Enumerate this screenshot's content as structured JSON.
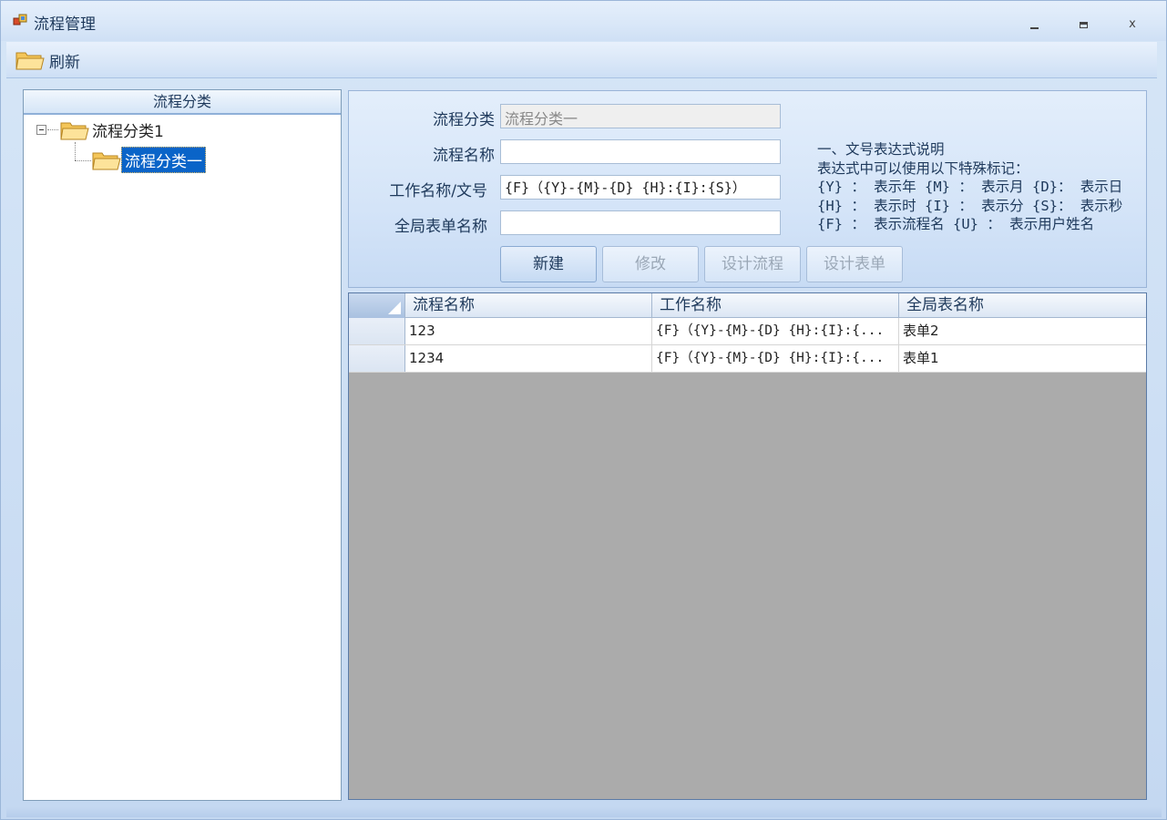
{
  "window": {
    "title": "流程管理",
    "minimize": "–",
    "maximize": "□",
    "close": "x"
  },
  "toolbar": {
    "refresh_label": "刷新"
  },
  "tree": {
    "header": "流程分类",
    "root": "流程分类1",
    "child": "流程分类一"
  },
  "form": {
    "category_label": "流程分类",
    "category_value": "流程分类一",
    "name_label": "流程名称",
    "name_value": "",
    "work_label": "工作名称/文号",
    "work_value": "{F}（{Y}-{M}-{D} {H}:{I}:{S}）",
    "form_label": "全局表单名称",
    "form_value": ""
  },
  "hint": {
    "line1": "一、文号表达式说明",
    "line2": "表达式中可以使用以下特殊标记：",
    "line3": "{Y} ： 表示年 {M} ： 表示月 {D}： 表示日",
    "line4": "{H} ： 表示时 {I} ： 表示分 {S}： 表示秒",
    "line5": "{F} ： 表示流程名 {U} ： 表示用户姓名"
  },
  "buttons": {
    "new": "新建",
    "edit": "修改",
    "design_flow": "设计流程",
    "design_form": "设计表单"
  },
  "grid": {
    "columns": [
      "流程名称",
      "工作名称",
      "全局表名称"
    ],
    "rows": [
      {
        "name": "123",
        "work": "{F}（{Y}-{M}-{D} {H}:{I}:{...",
        "form": "表单2"
      },
      {
        "name": "1234",
        "work": "{F}（{Y}-{M}-{D} {H}:{I}:{...",
        "form": "表单1"
      }
    ]
  },
  "colors": {
    "selection": "#0a64c8",
    "grid_empty": "#ababab",
    "panel": "#d4e4f8"
  }
}
